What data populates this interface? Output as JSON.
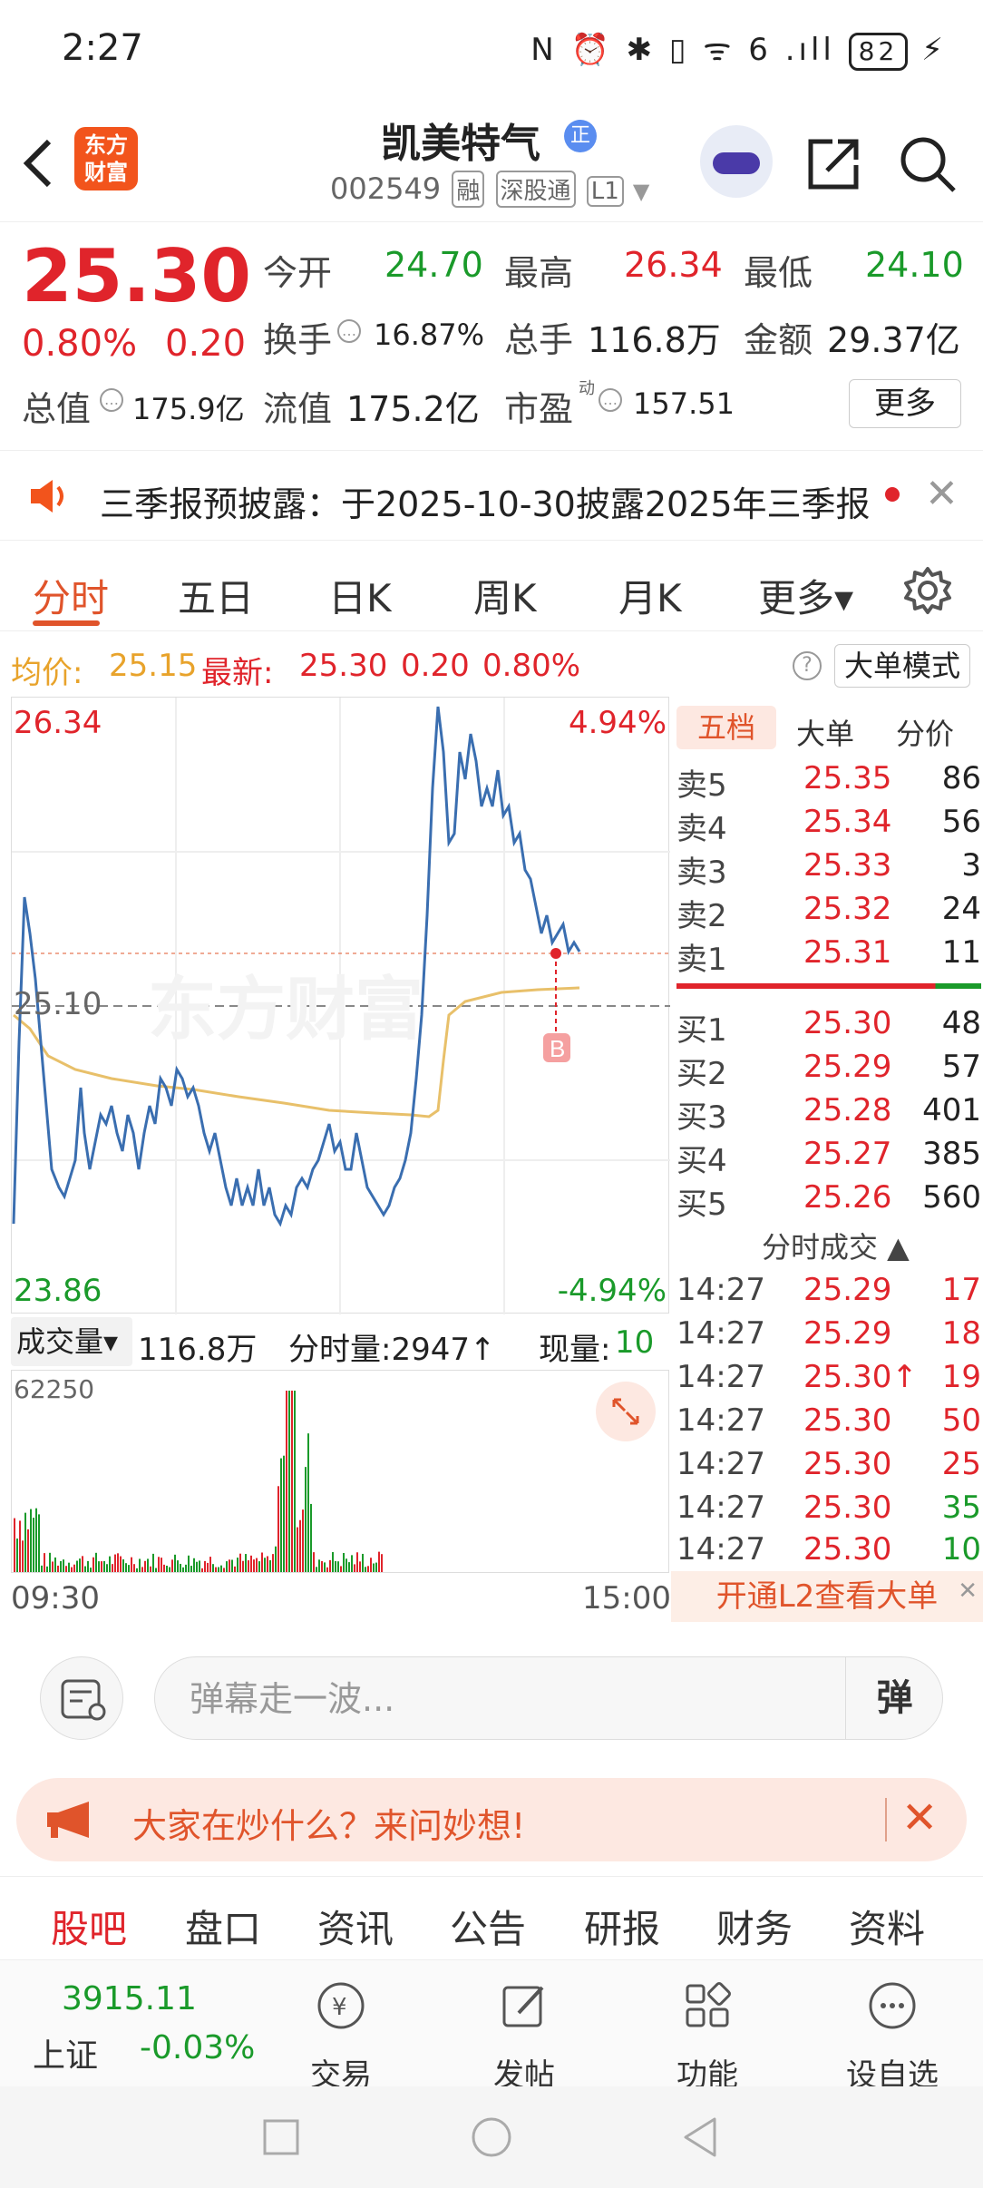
{
  "status_bar": {
    "time": "2:27",
    "icons": "N ⏰ ✱ ▯ ᯤ 6 .ıll",
    "battery": "82"
  },
  "header": {
    "logo_line1": "东方",
    "logo_line2": "财富",
    "stock_name": "凯美特气",
    "badge": "正",
    "code": "002549",
    "tags": [
      "融",
      "深股通",
      "L1"
    ]
  },
  "quote": {
    "price": "25.30",
    "change_pct": "0.80%",
    "change": "0.20",
    "open_label": "今开",
    "open": "24.70",
    "high_label": "最高",
    "high": "26.34",
    "low_label": "最低",
    "low": "24.10",
    "turnover_label": "换手",
    "turnover": "16.87%",
    "volume_label": "总手",
    "volume": "116.8万",
    "amount_label": "金额",
    "amount": "29.37亿",
    "mktcap_label": "总值",
    "mktcap": "175.9亿",
    "float_label": "流值",
    "float": "175.2亿",
    "pe_label": "市盈",
    "pe_sup": "动",
    "pe": "157.51",
    "more": "更多"
  },
  "notice": {
    "text": "三季报预披露：于2025-10-30披露2025年三季报"
  },
  "tabs": [
    "分时",
    "五日",
    "日K",
    "周K",
    "月K",
    "更多▾"
  ],
  "avg_bar": {
    "avg_label": "均价:",
    "avg": "25.15",
    "latest_label": "最新:",
    "latest": "25.30",
    "chg": "0.20",
    "pct": "0.80%",
    "mode": "大单模式",
    "help": "?"
  },
  "chart": {
    "top_price": "26.34",
    "top_pct": "4.94%",
    "mid_price": "25.10",
    "bottom_price": "23.86",
    "bottom_pct": "-4.94%",
    "marker": "B",
    "watermark": "东方财富"
  },
  "volume_bar": {
    "label": "成交量▾",
    "total": "116.8万",
    "minute_label": "分时量:2947↑",
    "now_label": "现量:",
    "now": "10",
    "max": "62250",
    "time_start": "09:30",
    "time_end": "15:00"
  },
  "depth": {
    "tabs": [
      "五档",
      "大单",
      "分价"
    ],
    "sells": [
      {
        "label": "卖5",
        "price": "25.35",
        "vol": "86"
      },
      {
        "label": "卖4",
        "price": "25.34",
        "vol": "56"
      },
      {
        "label": "卖3",
        "price": "25.33",
        "vol": "3"
      },
      {
        "label": "卖2",
        "price": "25.32",
        "vol": "24"
      },
      {
        "label": "卖1",
        "price": "25.31",
        "vol": "11"
      }
    ],
    "buys": [
      {
        "label": "买1",
        "price": "25.30",
        "vol": "48"
      },
      {
        "label": "买2",
        "price": "25.29",
        "vol": "57"
      },
      {
        "label": "买3",
        "price": "25.28",
        "vol": "401"
      },
      {
        "label": "买4",
        "price": "25.27",
        "vol": "385"
      },
      {
        "label": "买5",
        "price": "25.26",
        "vol": "560"
      }
    ],
    "trades_title": "分时成交 ▲",
    "trades": [
      {
        "time": "14:27",
        "price": "25.29",
        "vol": "17",
        "color": "#e0242b"
      },
      {
        "time": "14:27",
        "price": "25.29",
        "vol": "18",
        "color": "#e0242b"
      },
      {
        "time": "14:27",
        "price": "25.30↑",
        "vol": "19",
        "color": "#e0242b"
      },
      {
        "time": "14:27",
        "price": "25.30",
        "vol": "50",
        "color": "#e0242b"
      },
      {
        "time": "14:27",
        "price": "25.30",
        "vol": "25",
        "color": "#e0242b"
      },
      {
        "time": "14:27",
        "price": "25.30",
        "vol": "35",
        "color": "#1a9a2a"
      },
      {
        "time": "14:27",
        "price": "25.30",
        "vol": "10",
        "color": "#1a9a2a"
      }
    ],
    "l2": "开通L2查看大单"
  },
  "danmu": {
    "placeholder": "弹幕走一波...",
    "send": "弹"
  },
  "ask": {
    "text": "大家在炒什么？来问妙想!"
  },
  "bottom_tabs": [
    "股吧",
    "盘口",
    "资讯",
    "公告",
    "研报",
    "财务",
    "资料"
  ],
  "footer": {
    "index_value": "3915.11",
    "index_name": "上证",
    "index_pct": "-0.03%",
    "items": [
      "交易",
      "发帖",
      "功能",
      "设自选"
    ]
  }
}
